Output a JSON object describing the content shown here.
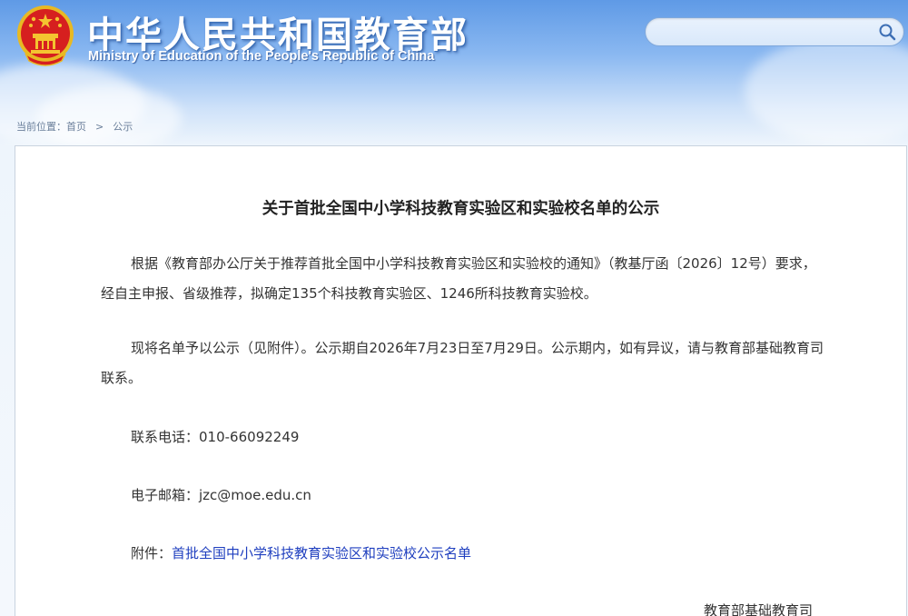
{
  "header": {
    "title_cn": "中华人民共和国教育部",
    "title_en": "Ministry of Education of the People's Republic of China",
    "search": {
      "value": "",
      "placeholder": ""
    }
  },
  "breadcrumb": {
    "prefix": "当前位置：",
    "items": [
      "首页",
      "公示"
    ],
    "separator": ">"
  },
  "article": {
    "title": "关于首批全国中小学科技教育实验区和实验校名单的公示",
    "paragraphs": [
      "根据《教育部办公厅关于推荐首批全国中小学科技教育实验区和实验校的通知》（教基厅函〔2026〕12号）要求，经自主申报、省级推荐，拟确定135个科技教育实验区、1246所科技教育实验校。",
      "现将名单予以公示（见附件）。公示期自2026年7月23日至7月29日。公示期内，如有异议，请与教育部基础教育司联系。"
    ],
    "phone_label": "联系电话：",
    "phone": "010-66092249",
    "email_label": "电子邮箱：",
    "email": "jzc@moe.edu.cn",
    "attachment_label": "附件：",
    "attachment_link": "首批全国中小学科技教育实验区和实验校公示名单",
    "signature": "教育部基础教育司"
  },
  "colors": {
    "header_blue": "#5f9ae6",
    "link": "#1f3fbf",
    "text": "#333333",
    "emblem_red": "#d61f1f",
    "emblem_gold": "#f4c430"
  },
  "icons": {
    "emblem": "national-emblem-icon",
    "search": "search-icon"
  }
}
